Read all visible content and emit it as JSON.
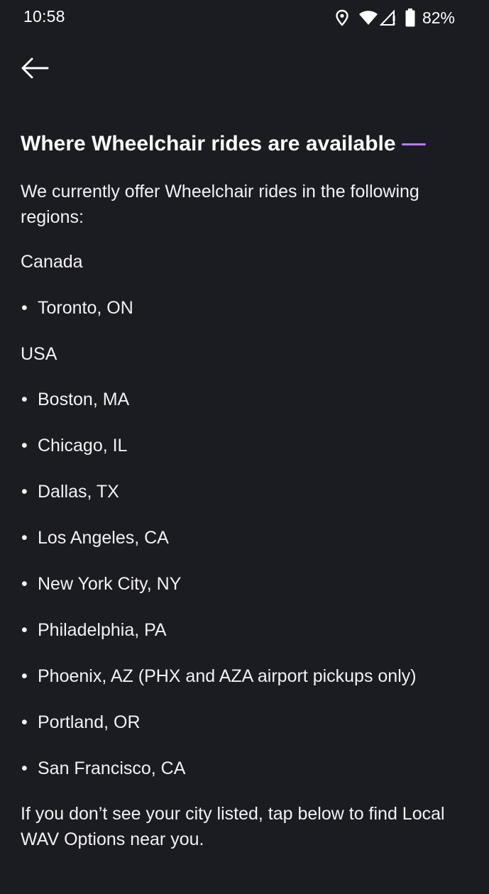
{
  "status_bar": {
    "time": "10:58",
    "icons": [
      "location-icon",
      "wifi-icon",
      "cell-signal-icon",
      "battery-icon"
    ],
    "battery_percent": "82%"
  },
  "nav": {
    "back_icon": "arrow-left-icon"
  },
  "page": {
    "title": "Where Wheelchair rides are available",
    "accent_color": "#b57ef0",
    "intro": "We currently offer Wheelchair rides in the following regions:",
    "regions": [
      {
        "name": "Canada",
        "cities": [
          "Toronto, ON"
        ]
      },
      {
        "name": "USA",
        "cities": [
          "Boston, MA",
          "Chicago, IL",
          "Dallas, TX",
          "Los Angeles, CA",
          "New York City, NY",
          "Philadelphia, PA",
          "Phoenix, AZ (PHX and AZA airport pickups only)",
          "Portland, OR",
          "San Francisco, CA"
        ]
      }
    ],
    "footer": "If you don’t see your city listed, tap below to find Local WAV Options near you."
  }
}
